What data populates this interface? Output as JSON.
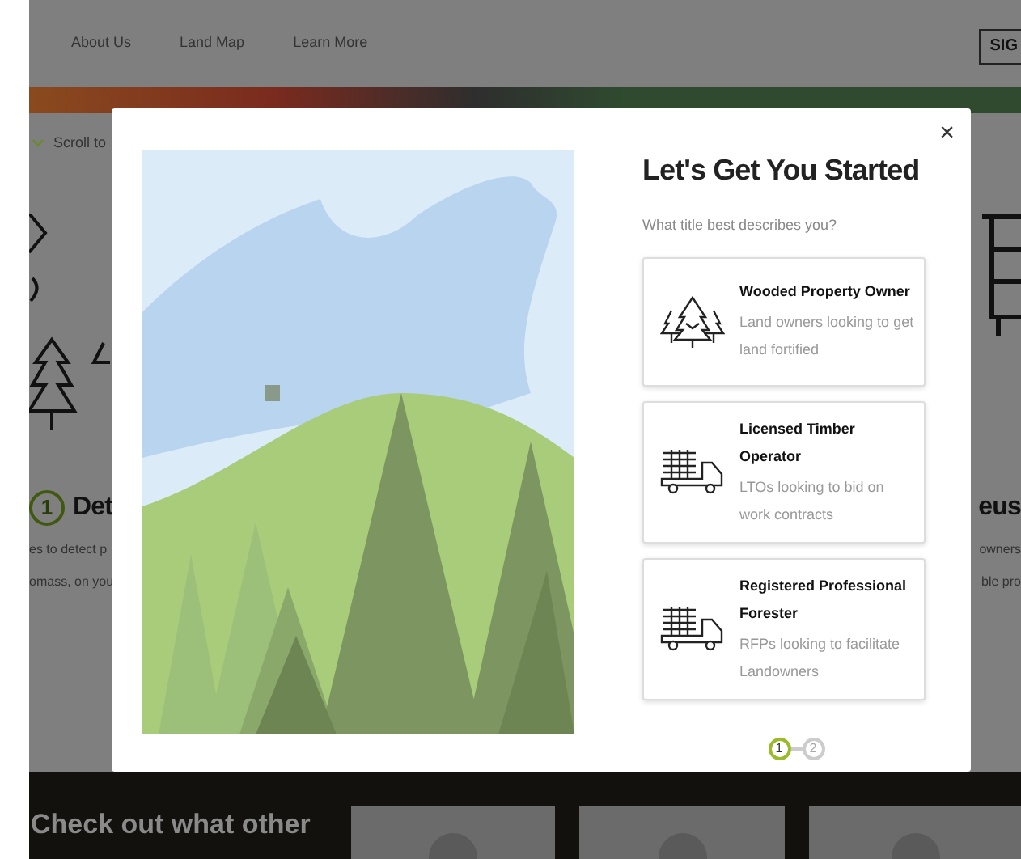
{
  "nav": {
    "links": [
      "About Us",
      "Land Map",
      "Learn More"
    ],
    "sign_button": "SIG"
  },
  "background": {
    "scroll_hint": "Scroll to",
    "left_step": {
      "number": "1",
      "title": "Det",
      "lines": [
        "es to detect p",
        "omass, on you"
      ]
    },
    "right_step": {
      "title": "eus",
      "lines": [
        "owners",
        "ble pro"
      ]
    }
  },
  "modal": {
    "title": "Let's Get You Started",
    "prompt": "What title best describes you?",
    "close": "×",
    "options": [
      {
        "kind": "trees",
        "title": "Wooded Property Owner",
        "description": "Land owners looking to get land fortified"
      },
      {
        "kind": "truck",
        "title": "Licensed Timber Operator",
        "description": "LTOs looking to bid on work contracts"
      },
      {
        "kind": "truck",
        "title": "Registered Professional Forester",
        "description": "RFPs looking to facilitate Landowners"
      }
    ],
    "steps": [
      {
        "label": "1",
        "selected": true
      },
      {
        "label": "2",
        "selected": false
      }
    ]
  },
  "bottom": {
    "heading": "Check out what other"
  }
}
